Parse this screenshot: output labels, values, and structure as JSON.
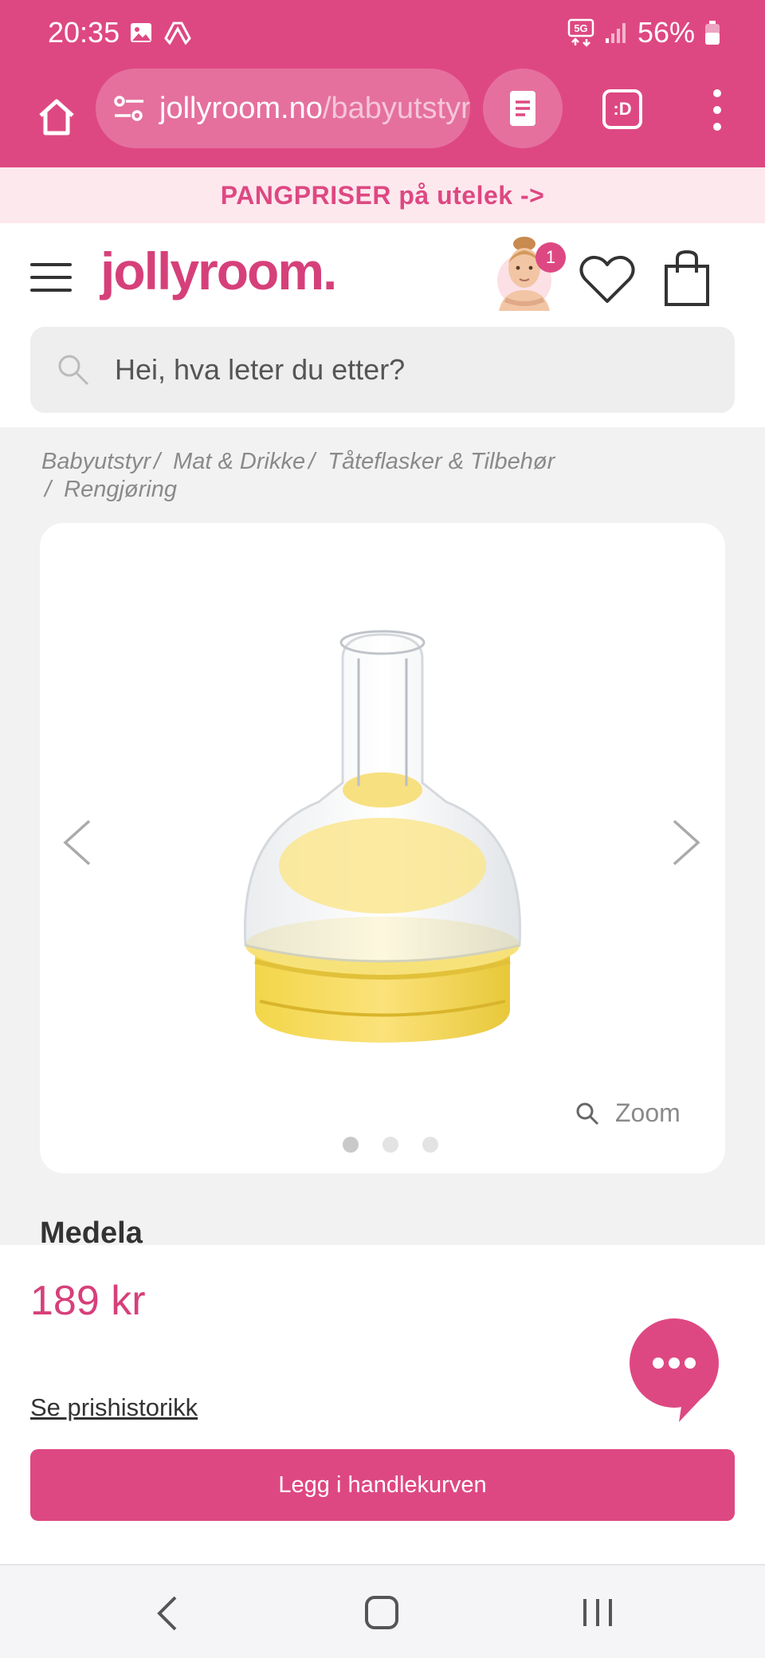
{
  "status_bar": {
    "time": "20:35",
    "network": "5G",
    "battery": "56%"
  },
  "browser": {
    "url_domain": "jollyroom.no",
    "url_path": "/babyutstyr",
    "tabs_label": ":D"
  },
  "promo_banner": {
    "text": "PANGPRISER på utelek ->"
  },
  "header": {
    "logo": "jollyroom.",
    "cart_badge": "1"
  },
  "search": {
    "placeholder": "Hei, hva leter du etter?"
  },
  "breadcrumb": [
    "Babyutstyr",
    "Mat & Drikke",
    "Tåteflasker & Tilbehør",
    "Rengjøring"
  ],
  "product": {
    "brand": "Medela",
    "zoom_label": "Zoom",
    "image_count": 3,
    "active_image": 1
  },
  "buy": {
    "price": "189 kr",
    "price_history_link": "Se prishistorikk",
    "add_to_cart": "Legg i handlekurven"
  },
  "colors": {
    "brand_pink": "#de4882",
    "promo_bg": "#fde8ee",
    "page_bg": "#f2f2f2"
  },
  "icons": [
    "home-icon",
    "tune-icon",
    "reader-mode-icon",
    "tabs-icon",
    "more-vert-icon",
    "hamburger-icon",
    "avatar-icon",
    "heart-icon",
    "bag-icon",
    "search-icon",
    "chevron-left-icon",
    "chevron-right-icon",
    "zoom-icon",
    "chat-icon",
    "nav-back-icon",
    "nav-home-icon",
    "nav-recent-icon"
  ]
}
